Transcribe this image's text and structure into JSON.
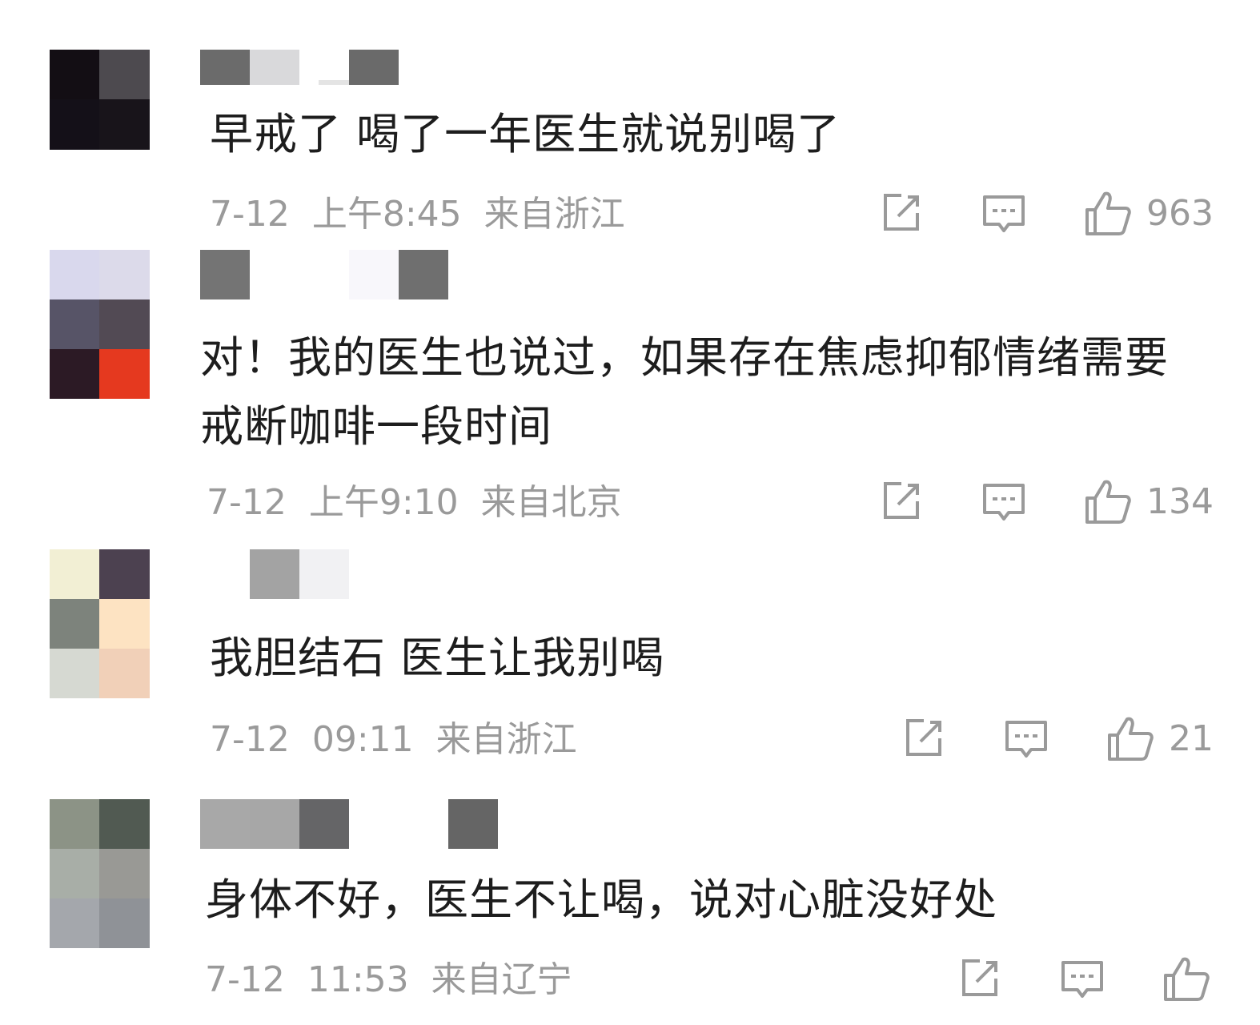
{
  "comments": [
    {
      "text": "早戒了 喝了一年医生就说别喝了",
      "date": "7-12",
      "time": "上午8:45",
      "location": "来自浙江",
      "likes": "963",
      "avatar_colors": [
        "#130e14",
        "#4d4a4f",
        "#141018",
        "#18141a"
      ],
      "username_blocks": [
        "#6b6b6b",
        "#d9d9db",
        "#ffffff",
        "#6a6a6a"
      ]
    },
    {
      "text": "对！我的医生也说过，如果存在焦虑抑郁情绪需要戒断咖啡一段时间",
      "date": "7-12",
      "time": "上午9:10",
      "location": "来自北京",
      "likes": "134",
      "avatar_colors": [
        "#d9d8ed",
        "#dcdaea",
        "#575467",
        "#524a54",
        "#2c1a25",
        "#e5391f"
      ],
      "username_blocks": [
        "#747474",
        "#ffffff",
        "#f8f7fb",
        "#6f6f6f"
      ]
    },
    {
      "text": "我胆结石 医生让我别喝",
      "date": "7-12",
      "time": "09:11",
      "location": "来自浙江",
      "likes": "21",
      "avatar_colors": [
        "#f2efd4",
        "#4c4150",
        "#7d837c",
        "#fde3c2",
        "#d6d9d2",
        "#f1d0b8"
      ],
      "username_blocks": [
        "#ffffff",
        "#a3a3a3",
        "#f1f1f3",
        "#ffffff"
      ]
    },
    {
      "text": "身体不好，医生不让喝，说对心脏没好处",
      "date": "7-12",
      "time": "11:53",
      "location": "来自辽宁",
      "likes": "",
      "avatar_colors": [
        "#8c9386",
        "#515a52",
        "#a8aea7",
        "#999995",
        "#a4a7ac",
        "#8f9297"
      ],
      "username_blocks": [
        "#a8a8a8",
        "#a7a7a7",
        "#656567",
        "#ffffff",
        "#ffffff",
        "#656565"
      ]
    }
  ],
  "icons": {
    "share": "share-icon",
    "comment": "comment-icon",
    "like": "thumbs-up-icon"
  },
  "colors": {
    "text": "#1d1d1d",
    "meta": "#9a9a9a"
  }
}
